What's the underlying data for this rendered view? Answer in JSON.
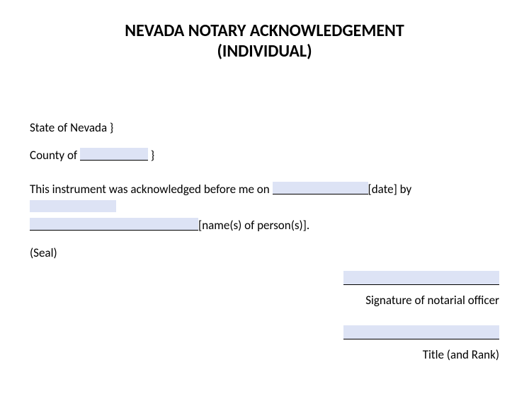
{
  "title_line1": "NEVADA NOTARY ACKNOWLEDGEMENT",
  "title_line2": "(INDIVIDUAL)",
  "state_line": "State of Nevada }",
  "county_prefix": "County of",
  "county_suffix": " }",
  "ack_prefix": "This instrument was acknowledged before me on",
  "ack_date_label": "[date] by",
  "ack_names_label": "[name(s) of person(s)].",
  "seal_label": "(Seal)",
  "signature_label": "Signature of notarial officer",
  "title_rank_label": "Title (and Rank)",
  "fields": {
    "county": "",
    "date": "",
    "names1": "",
    "names2": "",
    "signature": "",
    "title_rank": ""
  }
}
